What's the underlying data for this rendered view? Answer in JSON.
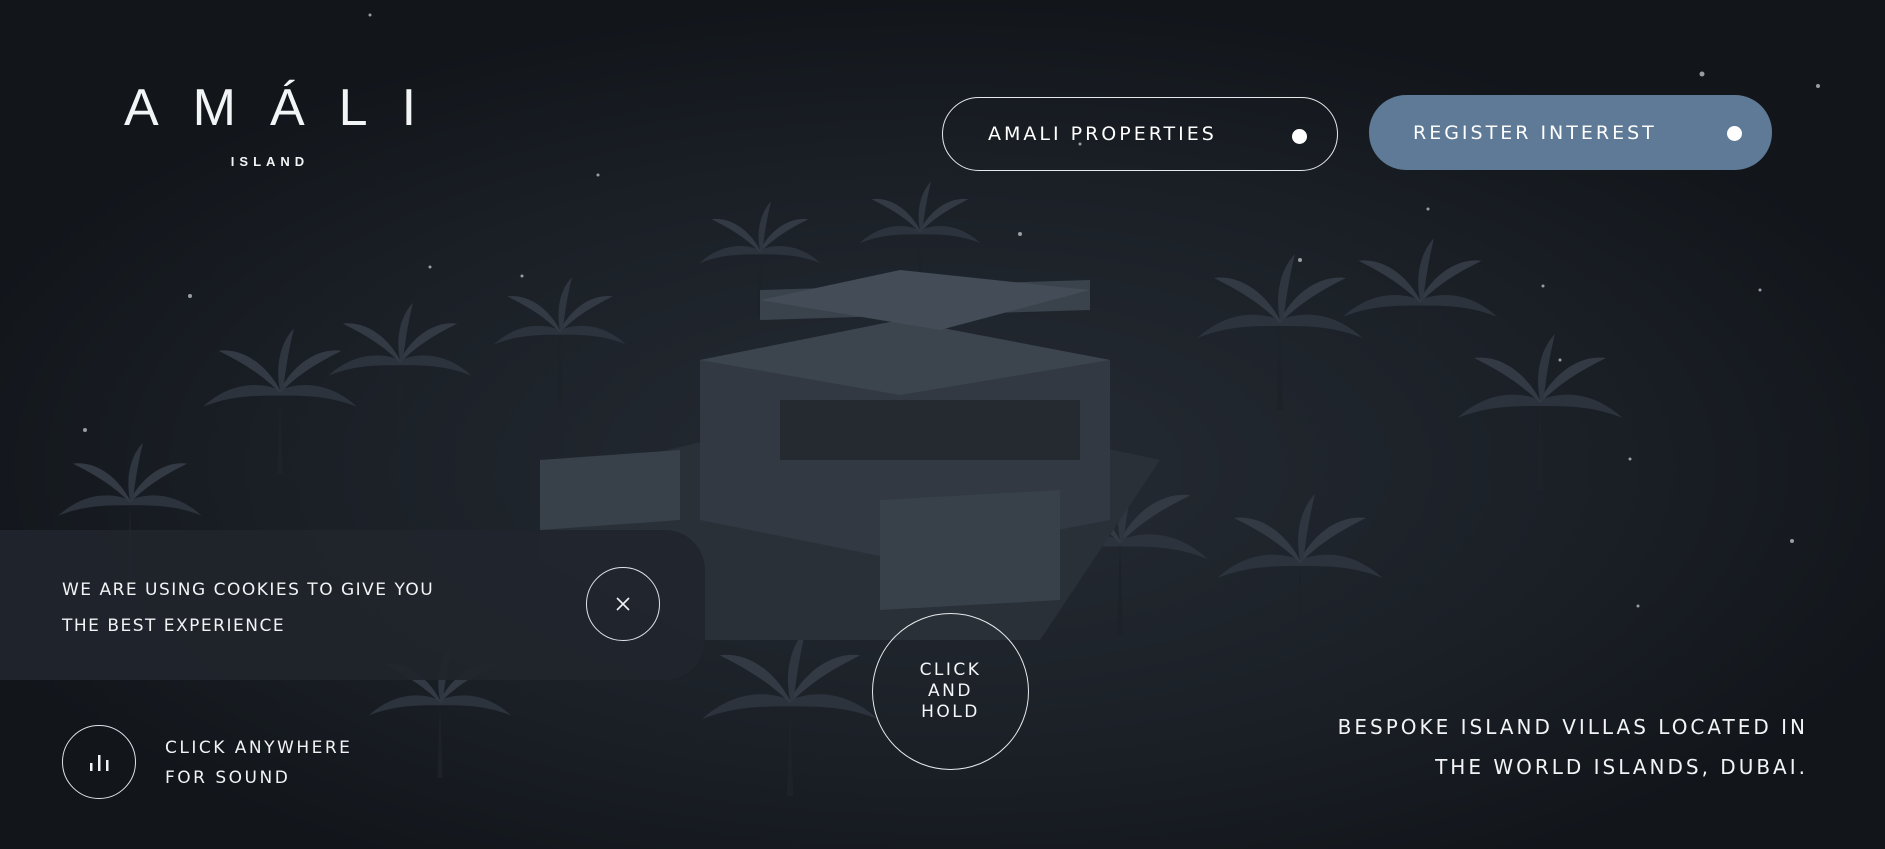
{
  "logo": {
    "wordmark": "AMÁLI",
    "sub": "ISLAND"
  },
  "header": {
    "properties_label": "AMALI PROPERTIES",
    "register_label": "REGISTER INTEREST"
  },
  "cookie": {
    "line1": "We are using cookies to give you",
    "line2": "the best experience"
  },
  "hold": {
    "line1": "Click",
    "line2": "and",
    "line3": "hold"
  },
  "sound": {
    "line1": "Click anywhere",
    "line2": "for sound"
  },
  "tagline": {
    "line1": "BESPOKE ISLAND VILLAS LOCATED IN",
    "line2": "THE WORLD ISLANDS, DUBAI."
  },
  "colors": {
    "background": "#14181d",
    "register_button": "#5e7a96",
    "cookie_panel": "#20252c",
    "text": "#f2f4f6"
  }
}
